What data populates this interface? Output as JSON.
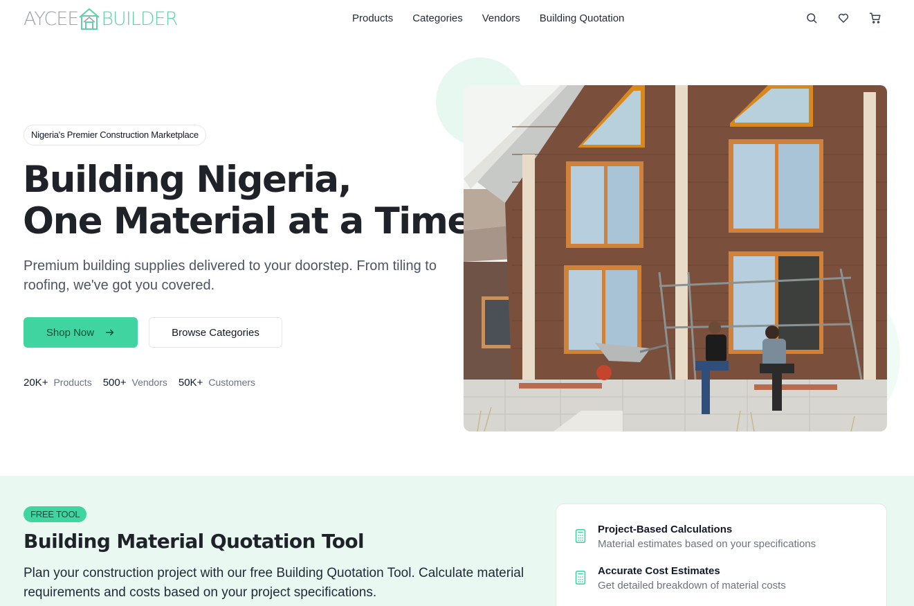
{
  "brand": {
    "name_part1": "AYCEE",
    "name_part2": "BUILDER",
    "accent_color": "#3fd4a0"
  },
  "nav": {
    "links": [
      "Products",
      "Categories",
      "Vendors",
      "Building Quotation"
    ],
    "icons": [
      "search-icon",
      "heart-icon",
      "cart-icon"
    ]
  },
  "hero": {
    "badge": "Nigeria's Premier Construction Marketplace",
    "title_line1": "Building Nigeria,",
    "title_line2": "One Material at a Time",
    "subtitle": "Premium building supplies delivered to your doorstep. From tiling to roofing, we've got you covered.",
    "primary_button": "Shop Now",
    "secondary_button": "Browse Categories",
    "stats": [
      {
        "value": "20K+",
        "label": "Products"
      },
      {
        "value": "500+",
        "label": "Vendors"
      },
      {
        "value": "50K+",
        "label": "Customers"
      }
    ]
  },
  "quotation": {
    "badge": "FREE TOOL",
    "title": "Building Material Quotation Tool",
    "description": "Plan your construction project with our free Building Quotation Tool. Calculate material requirements and costs based on your project specifications.",
    "features": [
      {
        "title": "Project-Based Calculations",
        "description": "Material estimates based on your specifications",
        "icon": "calculator-icon"
      },
      {
        "title": "Accurate Cost Estimates",
        "description": "Get detailed breakdown of material costs",
        "icon": "calculator-icon"
      }
    ]
  }
}
